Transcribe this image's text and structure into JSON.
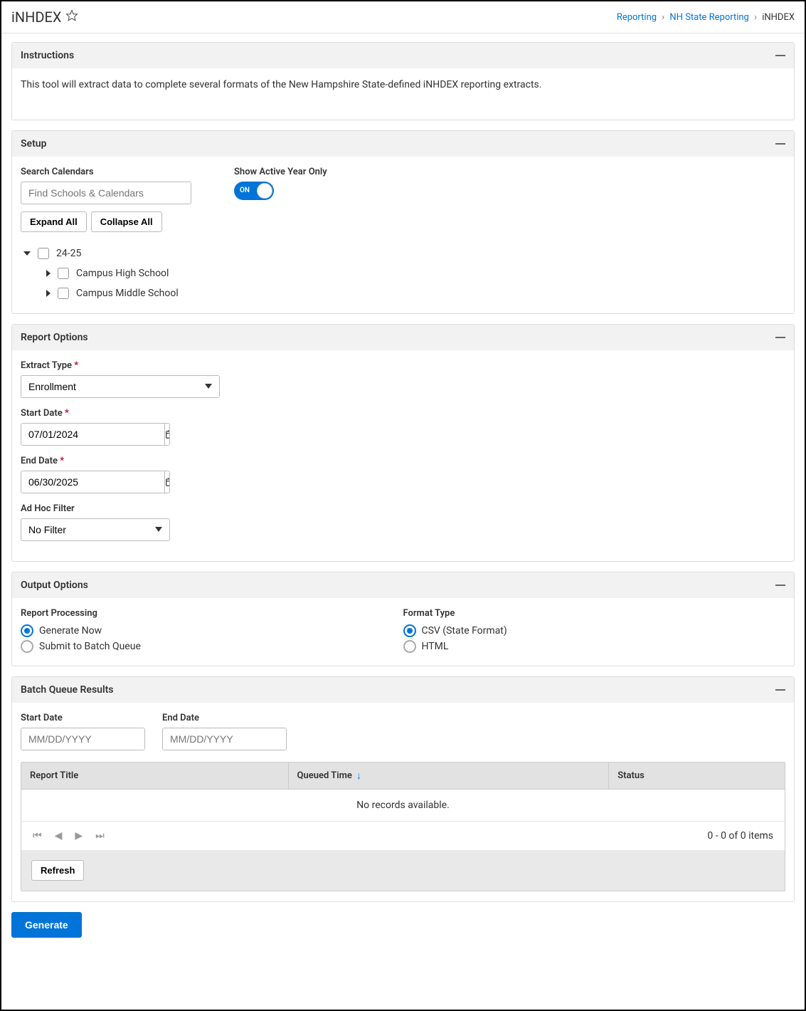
{
  "header": {
    "title": "iNHDEX",
    "breadcrumbs": [
      {
        "label": "Reporting",
        "link": true
      },
      {
        "label": "NH State Reporting",
        "link": true
      },
      {
        "label": "iNHDEX",
        "link": false
      }
    ]
  },
  "instructions": {
    "title": "Instructions",
    "text": "This tool will extract data to complete several formats of the New Hampshire State-defined iNHDEX reporting extracts."
  },
  "setup": {
    "title": "Setup",
    "search_label": "Search Calendars",
    "search_placeholder": "Find Schools & Calendars",
    "active_year_label": "Show Active Year Only",
    "toggle_state": "ON",
    "expand_btn": "Expand All",
    "collapse_btn": "Collapse All",
    "tree": {
      "root": "24-25",
      "children": [
        "Campus High School",
        "Campus Middle School"
      ]
    }
  },
  "report_options": {
    "title": "Report Options",
    "extract_type_label": "Extract Type",
    "extract_type_value": "Enrollment",
    "start_date_label": "Start Date",
    "start_date_value": "07/01/2024",
    "end_date_label": "End Date",
    "end_date_value": "06/30/2025",
    "adhoc_label": "Ad Hoc Filter",
    "adhoc_value": "No Filter"
  },
  "output_options": {
    "title": "Output Options",
    "processing_label": "Report Processing",
    "processing_options": [
      {
        "label": "Generate Now",
        "checked": true
      },
      {
        "label": "Submit to Batch Queue",
        "checked": false
      }
    ],
    "format_label": "Format Type",
    "format_options": [
      {
        "label": "CSV  (State Format)",
        "checked": true
      },
      {
        "label": "HTML",
        "checked": false
      }
    ]
  },
  "batch": {
    "title": "Batch Queue Results",
    "start_date_label": "Start Date",
    "start_date_placeholder": "MM/DD/YYYY",
    "end_date_label": "End Date",
    "end_date_placeholder": "MM/DD/YYYY",
    "columns": {
      "title": "Report Title",
      "queued": "Queued Time",
      "status": "Status"
    },
    "empty": "No records available.",
    "pager_text": "0 - 0 of 0 items",
    "refresh": "Refresh"
  },
  "footer": {
    "generate": "Generate"
  }
}
